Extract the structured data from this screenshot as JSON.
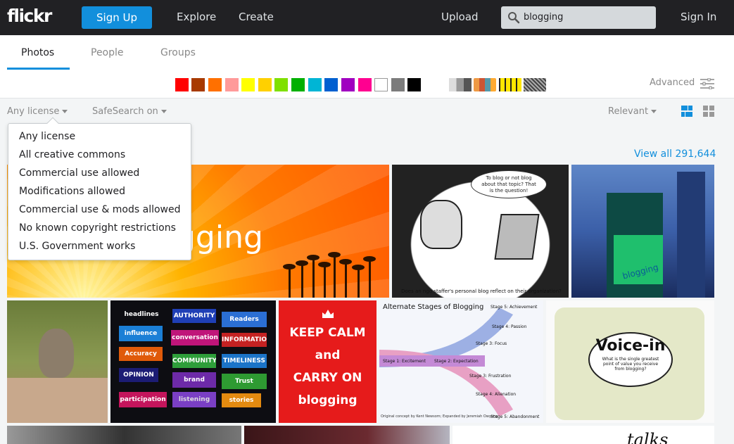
{
  "header": {
    "logo": "flickr",
    "signup": "Sign Up",
    "explore": "Explore",
    "create": "Create",
    "upload": "Upload",
    "search_value": "blogging",
    "signin": "Sign In"
  },
  "tabs": [
    "Photos",
    "People",
    "Groups"
  ],
  "color_swatches": [
    "#ff0000",
    "#a83a00",
    "#ff7000",
    "#ff9a9a",
    "#ffff00",
    "#ffd000",
    "#7fe000",
    "#00b000",
    "#00b5d5",
    "#0060d0",
    "#a000c0",
    "#ff0090",
    "#ffffff",
    "#7c7c7c",
    "#000000"
  ],
  "advanced_label": "Advanced",
  "filters": {
    "license": "Any license",
    "safesearch": "SafeSearch on",
    "sort": "Relevant"
  },
  "view_all": "View all 291,644",
  "license_menu": [
    "Any license",
    "All creative commons",
    "Commercial use allowed",
    "Modifications allowed",
    "Commercial use & mods allowed",
    "No known copyright restrictions",
    "U.S. Government works"
  ],
  "photos": {
    "banner_text": "gging",
    "cartoon_bubble": "To blog or not blog about that topic? That is the question!",
    "cartoon_caption": "Does an ngo staffer's personal blog reflect on their organization?",
    "building_text": "blogging",
    "words_tiles": [
      "headlines",
      "AUTHORITY",
      "Readers",
      "influence",
      "conversation",
      "INFORMATION",
      "Accuracy",
      "COMMUNITY",
      "TIMELINESS",
      "OPINION",
      "brand",
      "Trust",
      "participation",
      "listening",
      "stories"
    ],
    "keepcalm": [
      "KEEP CALM",
      "and",
      "CARRY ON",
      "blogging"
    ],
    "stages_title": "Alternate Stages of Blogging",
    "stages": [
      "Stage 5: Achievement",
      "Stage 4: Passion",
      "Stage 3: Focus",
      "Stage 1: Excitement",
      "Stage 2: Expectation",
      "Stage 3: Frustration",
      "Stage 4: Alienation",
      "Stage 5: Abandonment"
    ],
    "stages_credit": "Original concept by Kent Newsom; Expanded by Jeremiah Owyang",
    "voicein_title": "Voice-in",
    "voicein_sub": "What is the single greatest point of value you receive from blogging?",
    "bottom_text": "talks"
  },
  "colors": {
    "topbar": "#212124",
    "accent": "#128fdc"
  }
}
